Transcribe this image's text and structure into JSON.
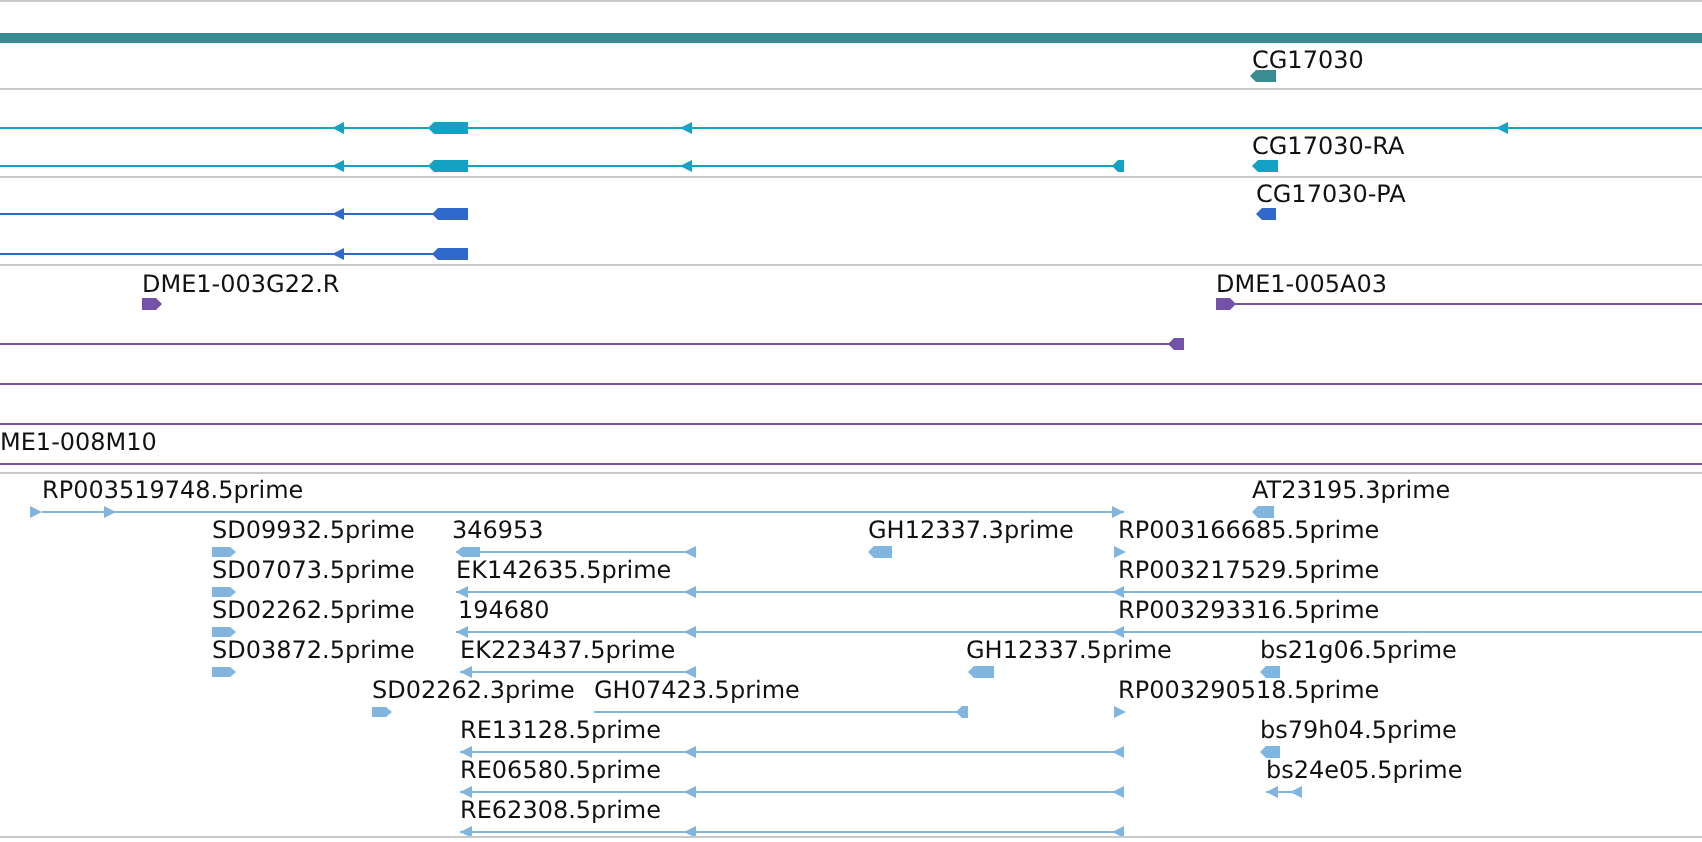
{
  "tracks": [
    {
      "kind": "gene",
      "features": [
        {
          "label": "CG17030"
        }
      ]
    },
    {
      "kind": "transcript",
      "features": [
        {
          "label": "CG17030-RA"
        }
      ]
    },
    {
      "kind": "protein",
      "features": [
        {
          "label": "CG17030-PA"
        }
      ]
    },
    {
      "kind": "clone",
      "features": [
        {
          "label": "DME1-003G22.R"
        },
        {
          "label": "DME1-005A03"
        },
        {
          "label": "ME1-008M10"
        }
      ]
    },
    {
      "kind": "est",
      "features": [
        {
          "label": "RP003519748.5prime"
        },
        {
          "label": "AT23195.3prime"
        },
        {
          "label": "SD09932.5prime"
        },
        {
          "label": "346953"
        },
        {
          "label": "GH12337.3prime"
        },
        {
          "label": "RP003166685.5prime"
        },
        {
          "label": "SD07073.5prime"
        },
        {
          "label": "EK142635.5prime"
        },
        {
          "label": "RP003217529.5prime"
        },
        {
          "label": "SD02262.5prime"
        },
        {
          "label": "194680"
        },
        {
          "label": "RP003293316.5prime"
        },
        {
          "label": "SD03872.5prime"
        },
        {
          "label": "EK223437.5prime"
        },
        {
          "label": "GH12337.5prime"
        },
        {
          "label": "bs21g06.5prime"
        },
        {
          "label": "SD02262.3prime"
        },
        {
          "label": "GH07423.5prime"
        },
        {
          "label": "RP003290518.5prime"
        },
        {
          "label": "RE13128.5prime"
        },
        {
          "label": "bs79h04.5prime"
        },
        {
          "label": "RE06580.5prime"
        },
        {
          "label": "bs24e05.5prime"
        },
        {
          "label": "RE62308.5prime"
        }
      ]
    }
  ]
}
